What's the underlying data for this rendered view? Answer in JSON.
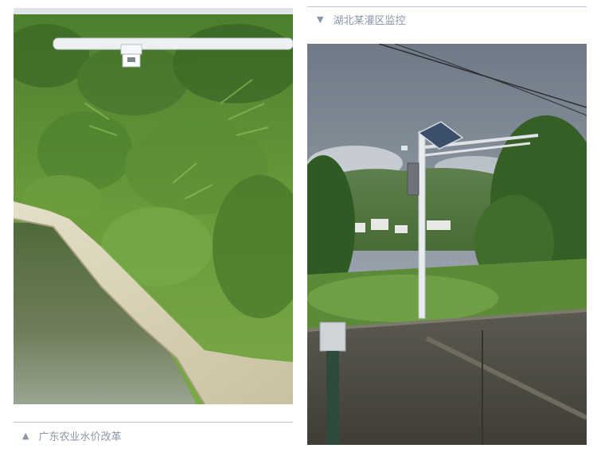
{
  "left_panel": {
    "caption_marker": "▲",
    "caption": "广东农业水价改革"
  },
  "right_panel": {
    "caption_marker": "▼",
    "caption": "湖北某灌区监控"
  },
  "colors": {
    "rule": "#b9c3cf",
    "caption_text": "#8a96a8",
    "vegetation_dark": "#3f6e2a",
    "vegetation_light": "#6f9e3c",
    "canal_concrete": "#d8d2b8",
    "water": "#5a6b4a",
    "sky_overcast": "#8d97a3"
  }
}
